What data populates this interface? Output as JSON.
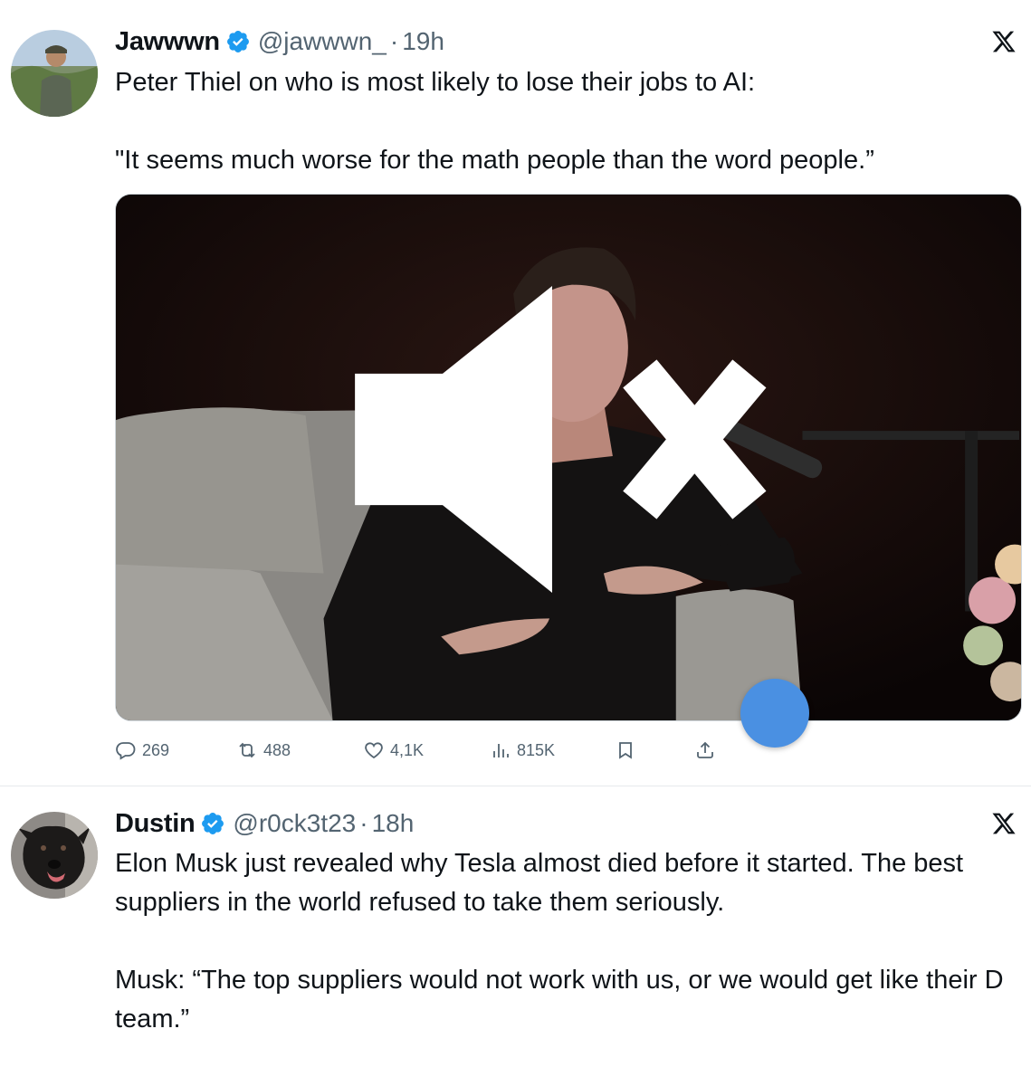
{
  "tweets": [
    {
      "author": {
        "name": "Jawwwn",
        "handle": "@jawwwn_",
        "time": "19h",
        "avatar_icon": "profile-photo"
      },
      "text": [
        "Peter Thiel on who is most likely to lose their jobs to AI:",
        "\"It seems much worse for the math people than the word people.”"
      ],
      "media": {
        "type": "video",
        "muted": true
      },
      "actions": {
        "replies": "269",
        "retweets": "488",
        "likes": "4,1K",
        "views": "815K"
      }
    },
    {
      "author": {
        "name": "Dustin",
        "handle": "@r0ck3t23",
        "time": "18h",
        "avatar_icon": "dog-photo"
      },
      "text": [
        "Elon Musk just revealed why Tesla almost died before it started. The best suppliers in the world refused to take them seriously.",
        "Musk: “The top suppliers would not work with us, or we would get like their D team.”"
      ]
    }
  ],
  "dot_separator": "·",
  "colors": {
    "accent": "#1d9bf0",
    "secondary_text": "#536471",
    "touch_indicator": "#4a90e2"
  }
}
